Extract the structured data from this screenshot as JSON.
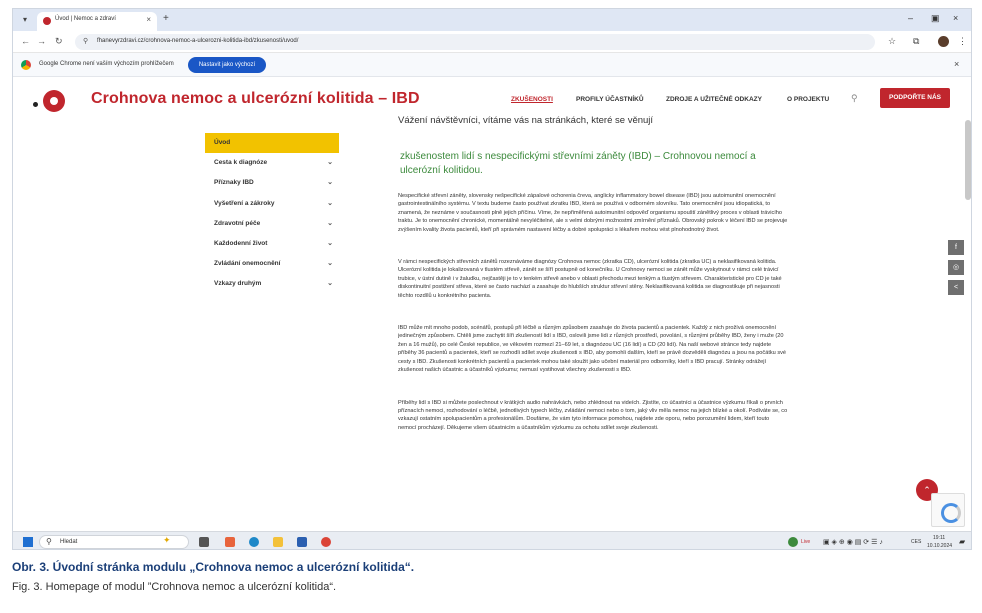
{
  "browser": {
    "tab_title": "Úvod | Nemoc a zdraví",
    "url": "fhanevyrzdravi.cz/crohnova-nemoc-a-ulcerozni-kolitida-ibd/zkusenosti/uvod/",
    "infobar_text": "Google Chrome není vaším výchozím prohlížečem",
    "infobar_button": "Nastavit jako výchozí"
  },
  "site": {
    "title": "Crohnova nemoc a ulcerózní kolitida – IBD",
    "nav": [
      {
        "label": "ZKUŠENOSTI",
        "active": true
      },
      {
        "label": "PROFILY ÚČASTNÍKŮ",
        "active": false
      },
      {
        "label": "ZDROJE A UŽITEČNÉ ODKAZY",
        "active": false
      },
      {
        "label": "O PROJEKTU",
        "active": false
      }
    ],
    "support_button": "PODPOŘTE NÁS"
  },
  "sidebar": {
    "items": [
      {
        "label": "Úvod",
        "active": true,
        "expandable": false
      },
      {
        "label": "Cesta k diagnóze",
        "active": false,
        "expandable": true
      },
      {
        "label": "Příznaky IBD",
        "active": false,
        "expandable": true
      },
      {
        "label": "Vyšetření a zákroky",
        "active": false,
        "expandable": true
      },
      {
        "label": "Zdravotní péče",
        "active": false,
        "expandable": true
      },
      {
        "label": "Každodenní život",
        "active": false,
        "expandable": true
      },
      {
        "label": "Zvládání onemocnění",
        "active": false,
        "expandable": true
      },
      {
        "label": "Vzkazy druhým",
        "active": false,
        "expandable": true
      }
    ]
  },
  "main": {
    "welcome": "Vážení návštěvníci, vítáme vás na stránkách, které se věnují",
    "heading": "zkušenostem lidí s nespecifickými střevními záněty (IBD) – Crohnovou nemocí a ulcerózní kolitidou.",
    "paragraphs": [
      "Nespecifické střevní záněty, slovensky nešpecifické zápalové ochorenia čreva, anglicky inflammatory bowel disease (IBD) jsou autoimunitní onemocnění gastrointestinálního systému. V textu budeme často používat zkratku IBD, která se používá v odborném slovníku. Tato onemocnění jsou idiopatická, to znamená, že neznáme v současnosti plně jejich příčinu. Víme, že nepřiměřená autoimunitní odpověď organismu spouští zánětlivý proces v oblasti trávicího traktu. Je to onemocnění chronické, momentálně nevyléčitelné, ale s velmi dobrými možnostmi zmírnění příznaků. Obrovský pokrok v léčení IBD se projevuje zvýšením kvality života pacientů, kteří při správném nastavení léčby a dobré spolupráci s lékařem mohou vést plnohodnotný život.",
      "V rámci nespecifických střevních zánětů rozeznáváme diagnózy Crohnova nemoc (zkratka CD), ulcerózní kolitida (zkratka UC) a neklasifikovaná kolitida. Ulcerózní kolitida je lokalizovaná v tlustém střevě, zánět se šíří postupně od konečníku. U Crohnovy nemoci se zánět může vyskytnout v rámci celé trávicí trubice, v ústní dutině i v žaludku, nejčastěji je to v tenkém střevě anebo v oblasti přechodu mezi tenkým a tlustým střevem. Charakteristické pro CD je také diskontinuitní postižení střeva, které se často nachází a zasahuje do hlubších struktur střevní stěny. Neklasifikovaná kolitida se diagnostikuje při nejasnosti těchto rozdílů u konkrétního pacienta.",
      "IBD může mít mnoho podob, scénářů, postupů při léčbě a různým způsobem zasahuje do života pacientů a pacientek. Každý z nich prožívá onemocnění jedinečným způsobem. Chtěli jsme zachytit šíři zkušeností lidí s IBD, oslovili jsme lidi z různých prostředí, povolání, s různými průběhy IBD, ženy i muže (20 žen a 16 mužů), po celé České republice, ve věkovém rozmezí 21–69 let, s diagnózou UC (16 lidí) a CD (20 lidí). Na naší webové stránce tedy najdete příběhy 36 pacientů a pacientek, kteří se rozhodli sdílet svoje zkušenosti s IBD, aby pomohli dalším, kteří se právě dozvěděli diagnózu a jsou na počátku své cesty s IBD. Zkušenosti konkrétních pacientů a pacientek mohou také sloužit jako učební materiál pro odborníky, kteří s IBD pracují. Stránky odrážejí zkušenost našich účastnic a účastníků výzkumu; nemusí vystihovat všechny zkušenosti s IBD.",
      "Příběhy lidí s IBD si můžete poslechnout v krátkých audio nahrávkách, nebo zhlédnout na videích. Zjistíte, co účastníci a účastnice výzkumu říkali o prvních příznacích nemoci, rozhodování o léčbě, jednotlivých typech léčby, zvládání nemoci nebo o tom, jaký vliv měla nemoc na jejich blízké a okolí. Podíváte se, co vzkazují ostatním spolupacientům a profesionálům. Doufáme, že vám tyto informace pomohou, najdete zde oporu, nebo porozumění lidem, kteří touto nemocí procházejí. Děkujeme všem účastnicím a účastníkům výzkumu za ochotu sdílet svoje zkušenosti."
    ]
  },
  "social": [
    {
      "name": "facebook-icon",
      "glyph": "f"
    },
    {
      "name": "instagram-icon",
      "glyph": "◎"
    },
    {
      "name": "share-icon",
      "glyph": "<"
    }
  ],
  "taskbar": {
    "search_label": "Hledat",
    "tray_label": "Live",
    "time": "19:11",
    "date": "10.10.2024",
    "lang": "CES"
  },
  "caption": {
    "cz": "Obr. 3. Úvodní stránka modulu „Crohnova nemoc a ulcerózní kolitida“.",
    "en": "Fig. 3. Homepage of modul ”Crohnova nemoc a ulcerózní kolitida“."
  },
  "colors": {
    "brand_red": "#c0262d",
    "sidebar_active": "#f2c200",
    "heading_green": "#3c8a3c"
  }
}
